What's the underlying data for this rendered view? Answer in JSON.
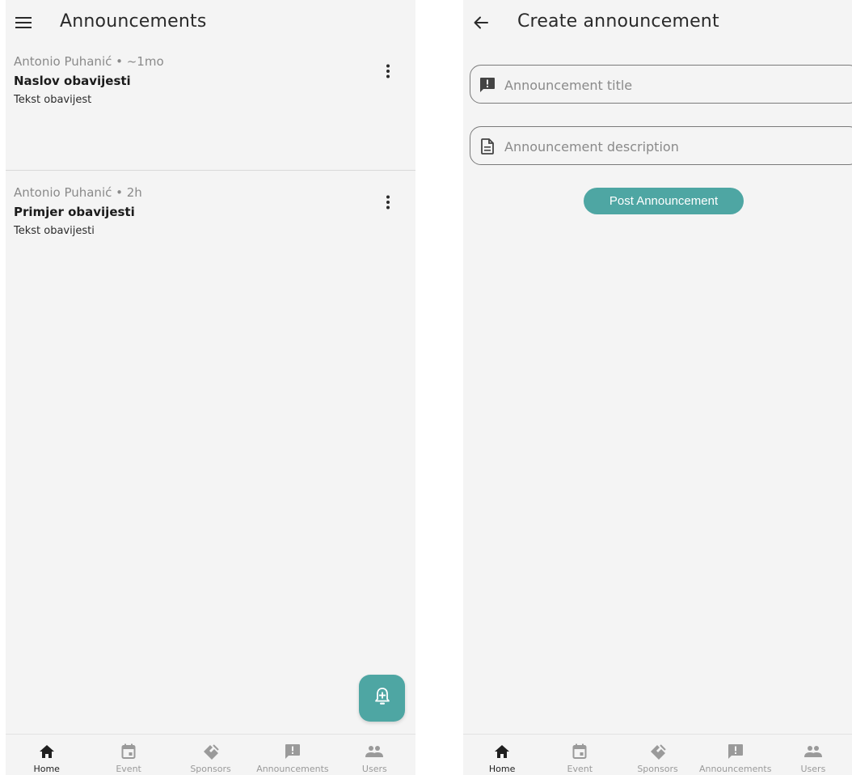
{
  "list_screen": {
    "title": "Announcements",
    "menu_icon": "hamburger-menu-icon",
    "announcements": [
      {
        "meta": "Antonio Puhanić • ~1mo",
        "title": "Naslov obavijesti",
        "body": "Tekst obavijest"
      },
      {
        "meta": "Antonio Puhanić • 2h",
        "title": "Primjer obavijesti",
        "body": "Tekst obavijesti"
      }
    ],
    "fab_icon": "add-notification-bell-icon"
  },
  "create_screen": {
    "title": "Create announcement",
    "back_icon": "arrow-back-icon",
    "title_field": {
      "placeholder": "Announcement title",
      "icon": "announcement-icon"
    },
    "description_field": {
      "placeholder": "Announcement description",
      "icon": "document-icon"
    },
    "post_button": "Post Announcement"
  },
  "bottom_nav": [
    {
      "label": "Home",
      "icon": "home-icon",
      "active": true
    },
    {
      "label": "Event",
      "icon": "calendar-icon",
      "active": false
    },
    {
      "label": "Sponsors",
      "icon": "handshake-icon",
      "active": false
    },
    {
      "label": "Announcements",
      "icon": "announcement-icon",
      "active": false
    },
    {
      "label": "Users",
      "icon": "users-icon",
      "active": false
    }
  ],
  "colors": {
    "accent": "#4ea6a3",
    "background": "#f4f4f4",
    "nav_inactive": "#9a9a9a",
    "nav_active": "#1f1f1f"
  }
}
